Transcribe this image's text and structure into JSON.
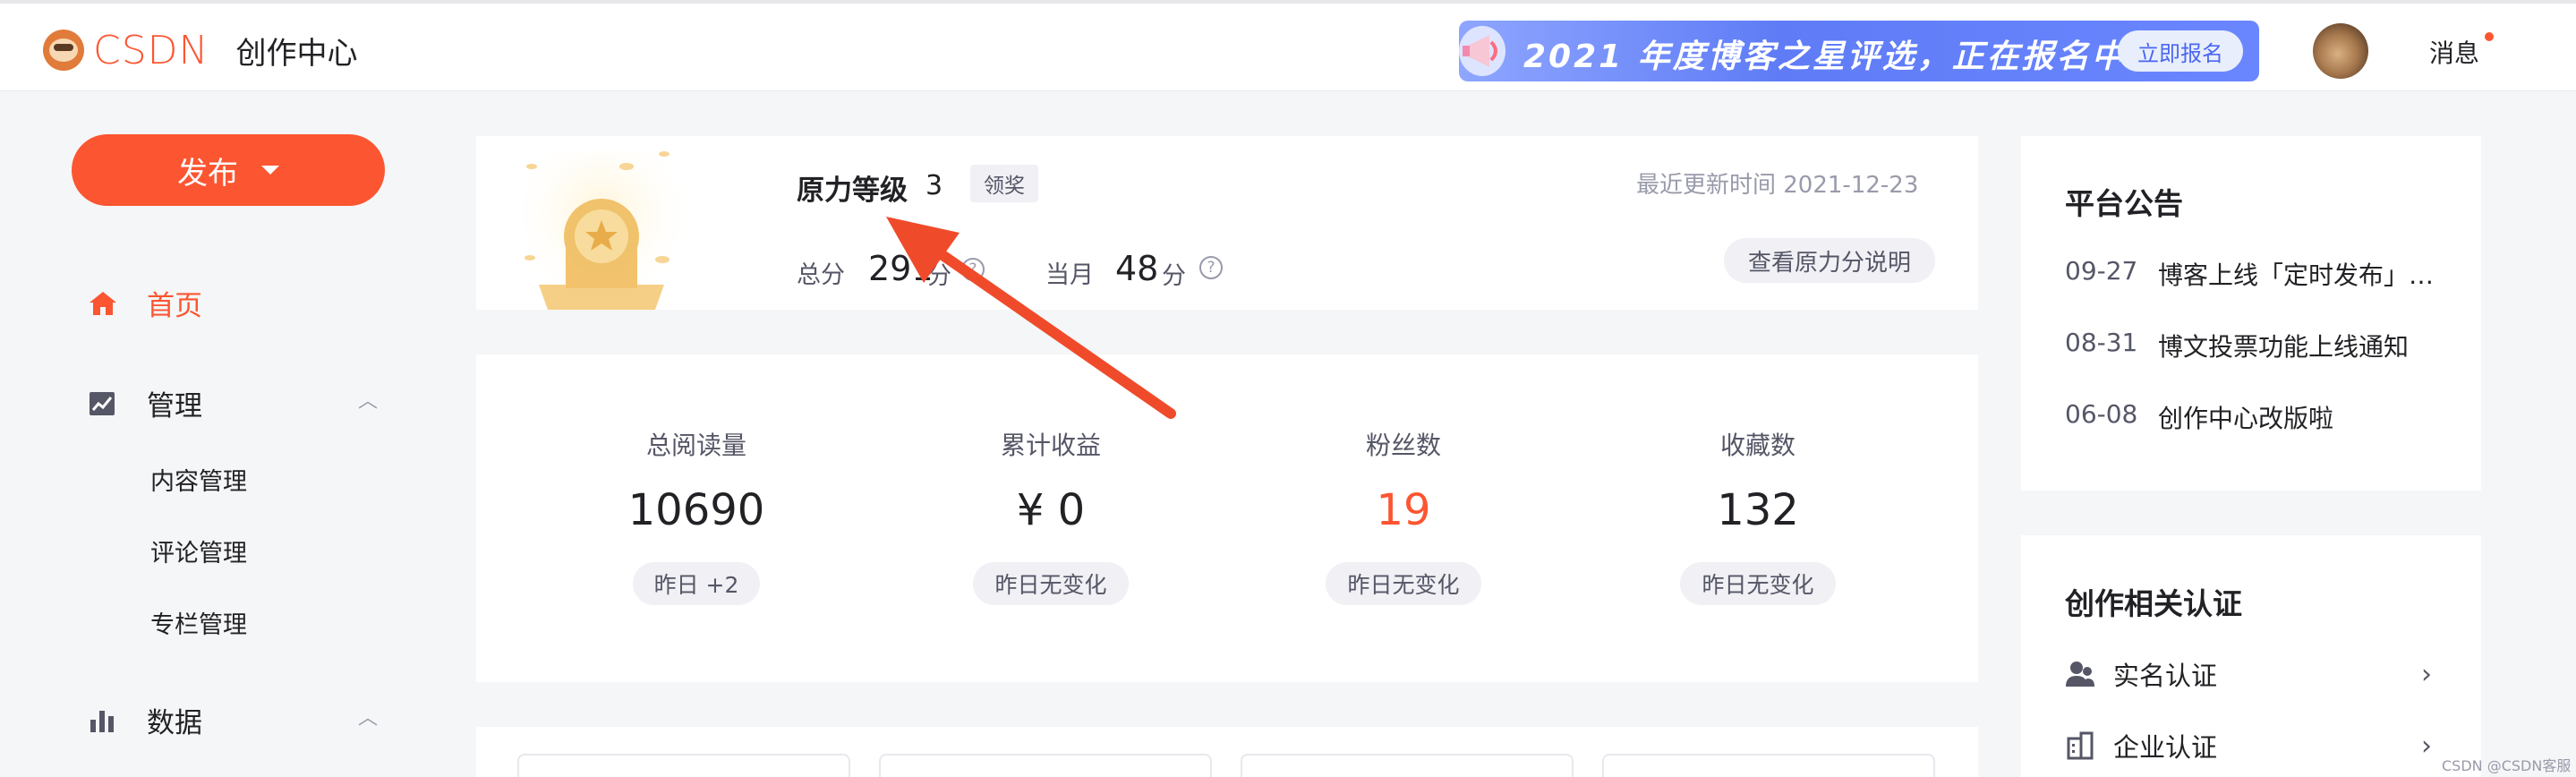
{
  "header": {
    "logo_text": "CSDN",
    "center_title": "创作中心",
    "banner_text": "2021 年度博客之星评选，正在报名中!",
    "banner_button": "立即报名",
    "messages_label": "消息"
  },
  "sidebar": {
    "publish_label": "发布",
    "items": [
      {
        "label": "首页",
        "icon": "home-icon",
        "active": true
      },
      {
        "label": "管理",
        "icon": "chart-line-icon",
        "expanded": true,
        "children": [
          "内容管理",
          "评论管理",
          "专栏管理"
        ]
      },
      {
        "label": "数据",
        "icon": "bar-chart-icon",
        "expanded": true
      }
    ]
  },
  "level_card": {
    "title": "原力等级",
    "level": "3",
    "claim_label": "领奖",
    "updated": "最近更新时间 2021-12-23",
    "total_label": "总分",
    "total_value": "291",
    "unit": "分",
    "month_label": "当月",
    "month_value": "48",
    "explain_button": "查看原力分说明"
  },
  "stats": [
    {
      "label": "总阅读量",
      "value": "10690",
      "change": "昨日 +2"
    },
    {
      "label": "累计收益",
      "value": "¥ 0",
      "change": "昨日无变化"
    },
    {
      "label": "粉丝数",
      "value": "19",
      "change": "昨日无变化"
    },
    {
      "label": "收藏数",
      "value": "132",
      "change": "昨日无变化"
    }
  ],
  "notices": {
    "title": "平台公告",
    "items": [
      {
        "date": "09-27",
        "text": "博客上线「定时发布」功能"
      },
      {
        "date": "08-31",
        "text": "博文投票功能上线通知"
      },
      {
        "date": "06-08",
        "text": "创作中心改版啦"
      }
    ]
  },
  "certs": {
    "title": "创作相关认证",
    "items": [
      {
        "label": "实名认证",
        "icon": "user-group-icon"
      },
      {
        "label": "企业认证",
        "icon": "building-icon"
      }
    ]
  },
  "watermark": "CSDN @CSDN客服",
  "colors": {
    "accent": "#fc5531",
    "fans_value": "#fc5531",
    "banner": "#5f7cf6"
  }
}
